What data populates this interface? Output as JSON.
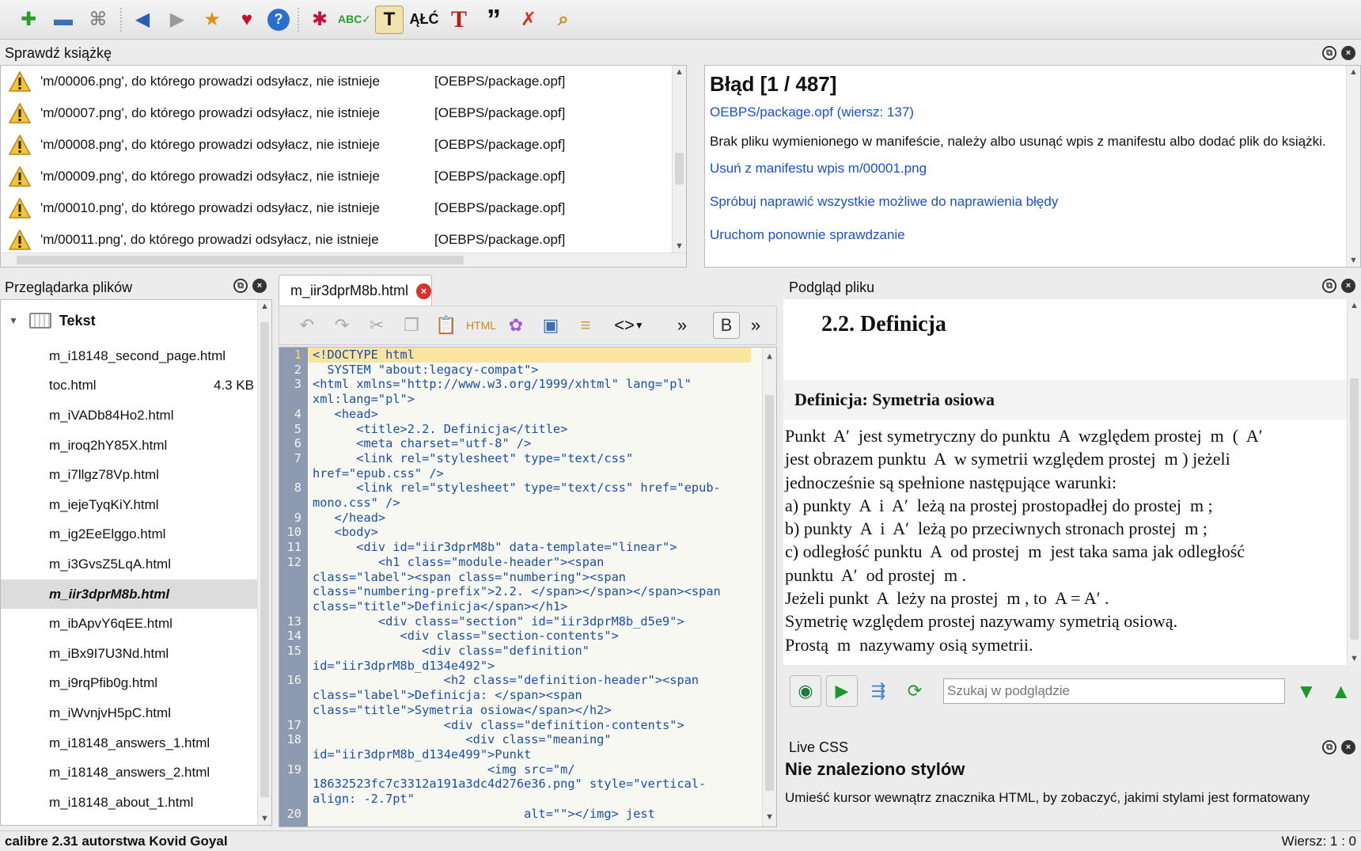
{
  "toolbar": {
    "icons": [
      "new-file-icon",
      "save-icon",
      "rename-icon",
      "back-icon",
      "forward-icon",
      "bookmark-icon",
      "heart-icon",
      "help-icon",
      "bug-icon",
      "spellcheck-icon",
      "text-icon",
      "character-icon",
      "font-icon",
      "quote-icon",
      "remove-icon",
      "search-icon"
    ]
  },
  "check_book": {
    "title": "Sprawdź książkę",
    "rows": [
      {
        "msg": "'m/00006.png', do którego prowadzi odsyłacz, nie istnieje",
        "loc": "[OEBPS/package.opf]"
      },
      {
        "msg": "'m/00007.png', do którego prowadzi odsyłacz, nie istnieje",
        "loc": "[OEBPS/package.opf]"
      },
      {
        "msg": "'m/00008.png', do którego prowadzi odsyłacz, nie istnieje",
        "loc": "[OEBPS/package.opf]"
      },
      {
        "msg": "'m/00009.png', do którego prowadzi odsyłacz, nie istnieje",
        "loc": "[OEBPS/package.opf]"
      },
      {
        "msg": "'m/00010.png', do którego prowadzi odsyłacz, nie istnieje",
        "loc": "[OEBPS/package.opf]"
      },
      {
        "msg": "'m/00011.png', do którego prowadzi odsyłacz, nie istnieje",
        "loc": "[OEBPS/package.opf]"
      }
    ]
  },
  "error": {
    "heading": "Błąd [1 / 487]",
    "location_link": "OEBPS/package.opf (wiersz: 137)",
    "description": "Brak pliku wymienionego w manifeście, należy albo usunąć wpis z manifestu albo dodać plik do książki.",
    "remove_link": "Usuń z manifestu wpis m/00001.png",
    "fix_all_link": "Spróbuj naprawić wszystkie możliwe do naprawienia błędy",
    "rerun_link": "Uruchom ponownie sprawdzanie"
  },
  "file_browser": {
    "title": "Przeglądarka plików",
    "group": "Tekst",
    "files": [
      {
        "name": "m_i18148_second_page.html",
        "size": ""
      },
      {
        "name": "toc.html",
        "size": "4.3 KB"
      },
      {
        "name": "m_iVADb84Ho2.html",
        "size": ""
      },
      {
        "name": "m_iroq2hY85X.html",
        "size": ""
      },
      {
        "name": "m_i7llgz78Vp.html",
        "size": ""
      },
      {
        "name": "m_iejeTyqKiY.html",
        "size": ""
      },
      {
        "name": "m_ig2EeElggo.html",
        "size": ""
      },
      {
        "name": "m_i3GvsZ5LqA.html",
        "size": ""
      },
      {
        "name": "m_iir3dprM8b.html",
        "size": ""
      },
      {
        "name": "m_ibApvY6qEE.html",
        "size": ""
      },
      {
        "name": "m_iBx9I7U3Nd.html",
        "size": ""
      },
      {
        "name": "m_i9rqPfib0g.html",
        "size": ""
      },
      {
        "name": "m_iWvnjvH5pC.html",
        "size": ""
      },
      {
        "name": "m_i18148_answers_1.html",
        "size": ""
      },
      {
        "name": "m_i18148_answers_2.html",
        "size": ""
      },
      {
        "name": "m_i18148_about_1.html",
        "size": ""
      }
    ],
    "active_index": 8
  },
  "editor": {
    "tab_label": "m_iir3dprM8b.html",
    "lines": [
      {
        "n": "1",
        "text": "<!DOCTYPE html"
      },
      {
        "n": "2",
        "text": "  SYSTEM \"about:legacy-compat\">"
      },
      {
        "n": "3",
        "text": "<html xmlns=\"http://www.w3.org/1999/xhtml\" lang=\"pl\"\nxml:lang=\"pl\">"
      },
      {
        "n": "4",
        "text": "   <head>"
      },
      {
        "n": "5",
        "text": "      <title>2.2. Definicja</title>"
      },
      {
        "n": "6",
        "text": "      <meta charset=\"utf-8\" />"
      },
      {
        "n": "7",
        "text": "      <link rel=\"stylesheet\" type=\"text/css\"\nhref=\"epub.css\" />"
      },
      {
        "n": "8",
        "text": "      <link rel=\"stylesheet\" type=\"text/css\" href=\"epub-\nmono.css\" />"
      },
      {
        "n": "9",
        "text": "   </head>"
      },
      {
        "n": "10",
        "text": "   <body>"
      },
      {
        "n": "11",
        "text": "      <div id=\"iir3dprM8b\" data-template=\"linear\">"
      },
      {
        "n": "12",
        "text": "         <h1 class=\"module-header\"><span\nclass=\"label\"><span class=\"numbering\"><span\nclass=\"numbering-prefix\">2.2. </span></span></span><span\nclass=\"title\">Definicja</span></h1>"
      },
      {
        "n": "13",
        "text": "         <div class=\"section\" id=\"iir3dprM8b_d5e9\">"
      },
      {
        "n": "14",
        "text": "            <div class=\"section-contents\">"
      },
      {
        "n": "15",
        "text": "               <div class=\"definition\"\nid=\"iir3dprM8b_d134e492\">"
      },
      {
        "n": "16",
        "text": "                  <h2 class=\"definition-header\"><span\nclass=\"label\">Definicja: </span><span\nclass=\"title\">Symetria osiowa</span></h2>"
      },
      {
        "n": "17",
        "text": "                  <div class=\"definition-contents\">"
      },
      {
        "n": "18",
        "text": "                     <div class=\"meaning\"\nid=\"iir3dprM8b_d134e499\">Punkt"
      },
      {
        "n": "19",
        "text": "                        <img src=\"m/\n18632523fc7c3312a191a3dc4d276e36.png\" style=\"vertical-\nalign: -2.7pt\""
      },
      {
        "n": "20",
        "text": "                             alt=\"\"></img> jest"
      }
    ]
  },
  "preview": {
    "title": "Podgląd pliku",
    "h1": "2.2. Definicja",
    "def_header": "Definicja: Symetria osiowa",
    "lines": [
      "Punkt  A′  jest symetryczny do punktu  A  względem prostej  m  (  A′",
      "jest obrazem punktu  A  w symetrii względem prostej  m ) jeżeli",
      "jednocześnie są spełnione następujące warunki:",
      "a) punkty  A  i  A′  leżą na prostej prostopadłej do prostej  m ;",
      "b) punkty  A  i  A′  leżą po przeciwnych stronach prostej  m ;",
      "c) odległość punktu  A  od prostej  m  jest taka sama jak odległość",
      "punktu  A′  od prostej  m .",
      "Jeżeli punkt  A  leży na prostej  m , to  A = A′ .",
      "Symetrię względem prostej nazywamy symetrią osiową.",
      "Prostą  m  nazywamy osią symetrii."
    ],
    "search_placeholder": "Szukaj w podglądzie"
  },
  "live_css": {
    "title": "Live CSS",
    "heading": "Nie znaleziono stylów",
    "text": "Umieść kursor wewnątrz znacznika HTML, by zobaczyć, jakimi stylami jest formatowany"
  },
  "status": {
    "left": "calibre 2.31 autorstwa Kovid Goyal",
    "right": "Wiersz: 1 : 0"
  }
}
